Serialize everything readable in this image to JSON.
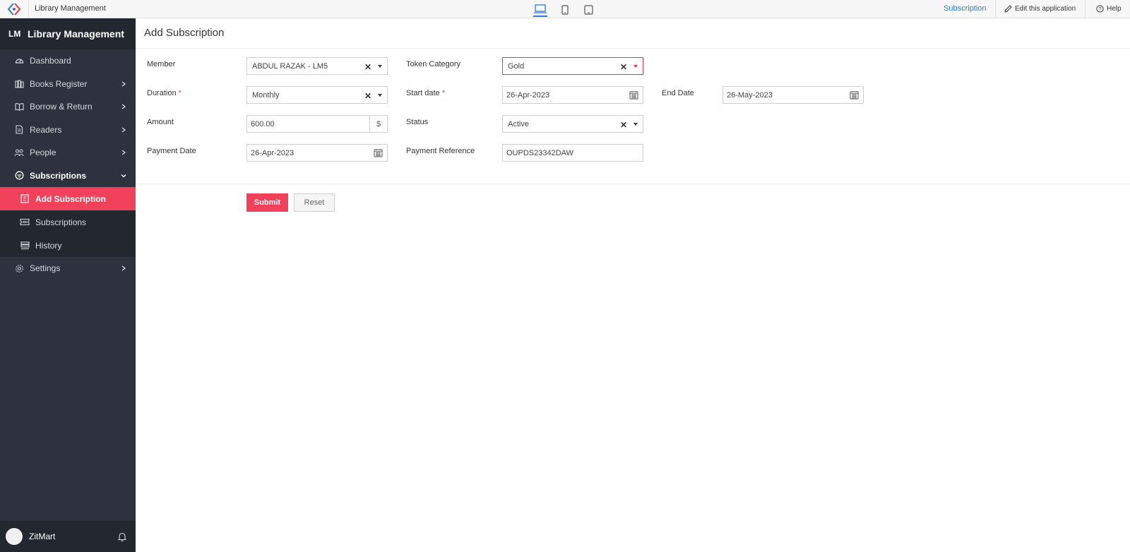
{
  "topbar": {
    "app_name": "Library Management",
    "subscription_link": "Subscription",
    "edit_link": "Edit this application",
    "help_link": "Help",
    "accent": "#2f7bd6"
  },
  "sidebar": {
    "brand_abbr": "LM",
    "brand_name": "Library Management",
    "items": [
      {
        "label": "Dashboard",
        "icon": "dashboard-icon"
      },
      {
        "label": "Books Register",
        "icon": "books-icon"
      },
      {
        "label": "Borrow & Return",
        "icon": "book-open-icon"
      },
      {
        "label": "Readers",
        "icon": "readers-icon"
      },
      {
        "label": "People",
        "icon": "people-icon"
      },
      {
        "label": "Subscriptions",
        "icon": "subscriptions-icon"
      },
      {
        "label": "Settings",
        "icon": "gear-icon"
      }
    ],
    "subitems": [
      {
        "label": "Add Subscription",
        "icon": "add-subscription-icon"
      },
      {
        "label": "Subscriptions",
        "icon": "ticket-icon"
      },
      {
        "label": "History",
        "icon": "history-icon"
      }
    ],
    "user_name": "ZitMart",
    "active_color": "#f2415a"
  },
  "main": {
    "page_title": "Add Subscription",
    "fields": {
      "member": {
        "label": "Member",
        "value": "ABDUL RAZAK - LM5"
      },
      "token_category": {
        "label": "Token Category",
        "value": "Gold"
      },
      "duration": {
        "label": "Duration",
        "required": "*",
        "value": "Monthly"
      },
      "start_date": {
        "label": "Start date",
        "required": "*",
        "value": "26-Apr-2023"
      },
      "end_date": {
        "label": "End Date",
        "value": "26-May-2023"
      },
      "amount": {
        "label": "Amount",
        "value": "600.00",
        "suffix": "$"
      },
      "status": {
        "label": "Status",
        "value": "Active"
      },
      "payment_date": {
        "label": "Payment Date",
        "value": "26-Apr-2023"
      },
      "payment_reference": {
        "label": "Payment Reference",
        "value": "OUPDS23342DAW"
      }
    },
    "submit_label": "Submit",
    "reset_label": "Reset"
  }
}
